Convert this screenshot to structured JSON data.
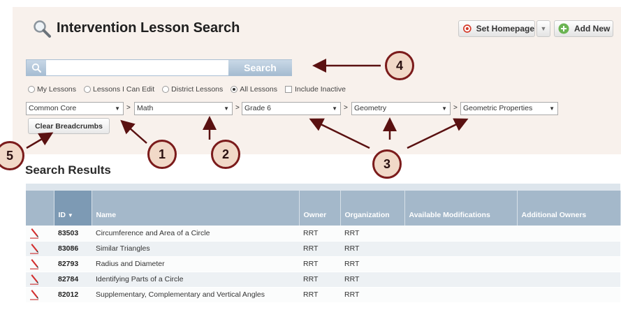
{
  "header": {
    "title": "Intervention Lesson Search",
    "title_icon": "magnifier-icon",
    "set_homepage_label": "Set Homepage",
    "set_homepage_icon": "target-icon",
    "add_new_label": "Add New",
    "add_new_icon": "plus-circle-icon"
  },
  "search": {
    "value": "",
    "placeholder": "",
    "button_label": "Search"
  },
  "filters": {
    "options": [
      "My Lessons",
      "Lessons I Can Edit",
      "District Lessons",
      "All Lessons"
    ],
    "selected": "All Lessons",
    "include_inactive_label": "Include Inactive",
    "include_inactive_checked": false
  },
  "breadcrumbs": {
    "selects": [
      "Common Core",
      "Math",
      "Grade 6",
      "Geometry",
      "Geometric Properties"
    ],
    "separator": ">",
    "clear_label": "Clear Breadcrumbs"
  },
  "results": {
    "heading": "Search Results",
    "columns": [
      "ID",
      "Name",
      "Owner",
      "Organization",
      "Available Modifications",
      "Additional Owners"
    ],
    "sort_indicator": "▼",
    "rows": [
      {
        "id": "83503",
        "name": "Circumference and Area of a Circle",
        "owner": "RRT",
        "organization": "RRT"
      },
      {
        "id": "83086",
        "name": "Similar Triangles",
        "owner": "RRT",
        "organization": "RRT"
      },
      {
        "id": "82793",
        "name": "Radius and Diameter",
        "owner": "RRT",
        "organization": "RRT"
      },
      {
        "id": "82784",
        "name": "Identifying Parts of a Circle",
        "owner": "RRT",
        "organization": "RRT"
      },
      {
        "id": "82012",
        "name": "Supplementary, Complementary and Vertical Angles",
        "owner": "RRT",
        "organization": "RRT"
      }
    ]
  },
  "callouts": [
    "1",
    "2",
    "3",
    "4",
    "5"
  ],
  "colors": {
    "panel_bg": "#f8f1ec",
    "callout_border": "#7b1b1b",
    "callout_fill": "#f1d9c8",
    "table_header": "#a4b8ca",
    "table_header_active": "#7d9ab4",
    "search_button": "#a5bcd1"
  }
}
